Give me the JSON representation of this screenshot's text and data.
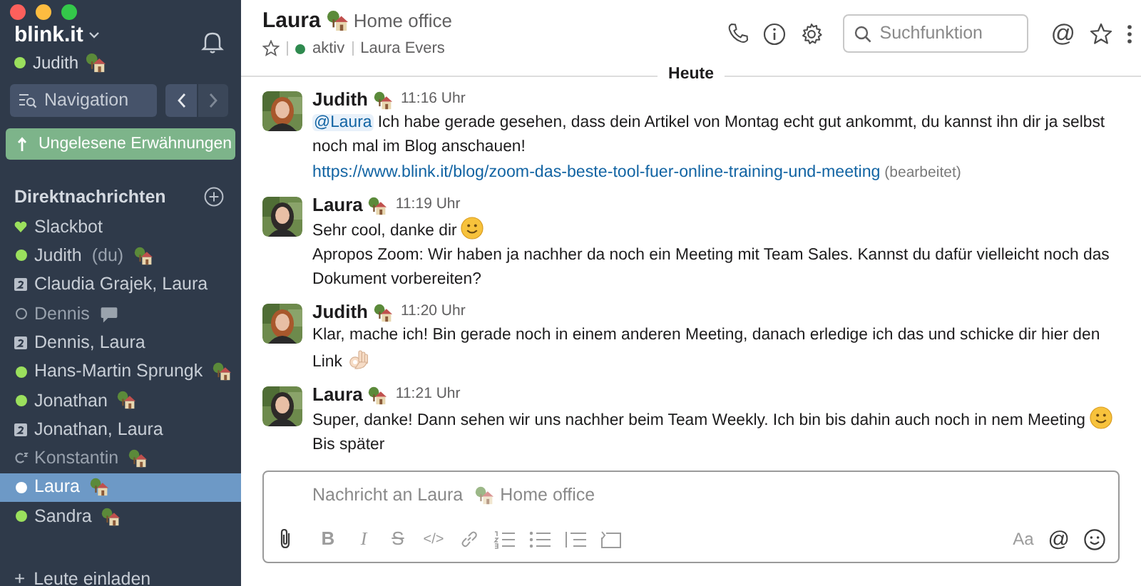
{
  "workspace": {
    "name": "blink.it",
    "user": "Judith",
    "online": true,
    "status": {
      "kind": "house"
    }
  },
  "navigation": {
    "label": "Navigation"
  },
  "unread_button": {
    "label": "Ungelesene Erwähnungen"
  },
  "direct_messages": {
    "title": "Direktnachrichten",
    "items": [
      {
        "kind": "bot",
        "name": "Slackbot",
        "selected": false
      },
      {
        "kind": "person",
        "name": "Judith",
        "suffix": "(du)",
        "online": true,
        "status": {
          "kind": "house"
        },
        "selected": false
      },
      {
        "kind": "group",
        "name": "Claudia Grajek, Laura",
        "selected": false
      },
      {
        "kind": "person",
        "name": "Dennis",
        "online": false,
        "status": {
          "kind": "bubble"
        },
        "selected": false
      },
      {
        "kind": "group",
        "name": "Dennis, Laura",
        "selected": false
      },
      {
        "kind": "person",
        "name": "Hans-Martin Sprungk",
        "online": true,
        "status": {
          "kind": "house"
        },
        "selected": false
      },
      {
        "kind": "person",
        "name": "Jonathan",
        "online": true,
        "status": {
          "kind": "house"
        },
        "selected": false
      },
      {
        "kind": "group",
        "name": "Jonathan, Laura",
        "selected": false
      },
      {
        "kind": "shared",
        "name": "Konstantin",
        "online": false,
        "status": {
          "kind": "house"
        },
        "selected": false
      },
      {
        "kind": "person",
        "name": "Laura",
        "online": true,
        "status": {
          "kind": "house"
        },
        "selected": true
      },
      {
        "kind": "person",
        "name": "Sandra",
        "online": true,
        "status": {
          "kind": "house"
        },
        "selected": false
      }
    ]
  },
  "invite": {
    "icon": "+",
    "label": "Leute einladen"
  },
  "header": {
    "title": "Laura",
    "status_text": "Home office",
    "starred": false,
    "presence_label": "aktiv",
    "full_name": "Laura Evers"
  },
  "search": {
    "placeholder": "Suchfunktion"
  },
  "mention_button": {
    "label": "@"
  },
  "day_divider": "Heute",
  "messages": [
    {
      "author": "Judith",
      "time": "11:16 Uhr",
      "paragraphs": [
        [
          {
            "kind": "mention",
            "text": "@Laura"
          },
          {
            "kind": "text",
            "text": " Ich habe gerade gesehen, dass dein Artikel von Montag echt gut ankommt, du kannst ihn dir ja selbst noch mal im Blog anschauen!"
          }
        ],
        [
          {
            "kind": "link",
            "text": "https://www.blink.it/blog/zoom-das-beste-tool-fuer-online-training-und-meeting"
          },
          {
            "kind": "note",
            "text": " (bearbeitet)"
          }
        ]
      ]
    },
    {
      "author": "Laura",
      "time": "11:19 Uhr",
      "paragraphs": [
        [
          {
            "kind": "text",
            "text": "Sehr cool, danke dir "
          },
          {
            "kind": "smile"
          }
        ],
        [
          {
            "kind": "text",
            "text": "Apropos Zoom: Wir haben ja nachher da noch ein Meeting mit Team Sales. Kannst du dafür vielleicht noch das Dokument vorbereiten?"
          }
        ]
      ]
    },
    {
      "author": "Judith",
      "time": "11:20 Uhr",
      "paragraphs": [
        [
          {
            "kind": "text",
            "text": "Klar, mache ich! Bin gerade noch in einem anderen Meeting, danach erledige ich das und schicke dir hier den Link "
          },
          {
            "kind": "ok_hand"
          }
        ]
      ]
    },
    {
      "author": "Laura",
      "time": "11:21 Uhr",
      "paragraphs": [
        [
          {
            "kind": "text",
            "text": "Super, danke! Dann sehen wir uns nachher beim Team Weekly. Ich bin bis dahin auch noch in nem Meeting "
          },
          {
            "kind": "smile"
          }
        ],
        [
          {
            "kind": "text",
            "text": "Bis später"
          }
        ]
      ]
    }
  ],
  "composer": {
    "placeholder": "Nachricht an Laura",
    "placeholder_status": "Home office",
    "tools": [
      {
        "kind": "attach",
        "disabled": false
      },
      {
        "kind": "bold",
        "label": "B",
        "disabled": true
      },
      {
        "kind": "italic",
        "label": "I",
        "disabled": true
      },
      {
        "kind": "strike",
        "label": "S",
        "disabled": true
      },
      {
        "kind": "code",
        "label": "</>",
        "disabled": true
      },
      {
        "kind": "link",
        "disabled": true
      },
      {
        "kind": "ordered",
        "disabled": true
      },
      {
        "kind": "bullets",
        "disabled": true
      },
      {
        "kind": "indent",
        "disabled": true
      },
      {
        "kind": "block",
        "disabled": true
      },
      {
        "kind": "spacer"
      },
      {
        "kind": "format",
        "label": "Aa",
        "disabled": true
      },
      {
        "kind": "at",
        "label": "@",
        "disabled": false
      },
      {
        "kind": "emoji",
        "disabled": false
      }
    ]
  }
}
